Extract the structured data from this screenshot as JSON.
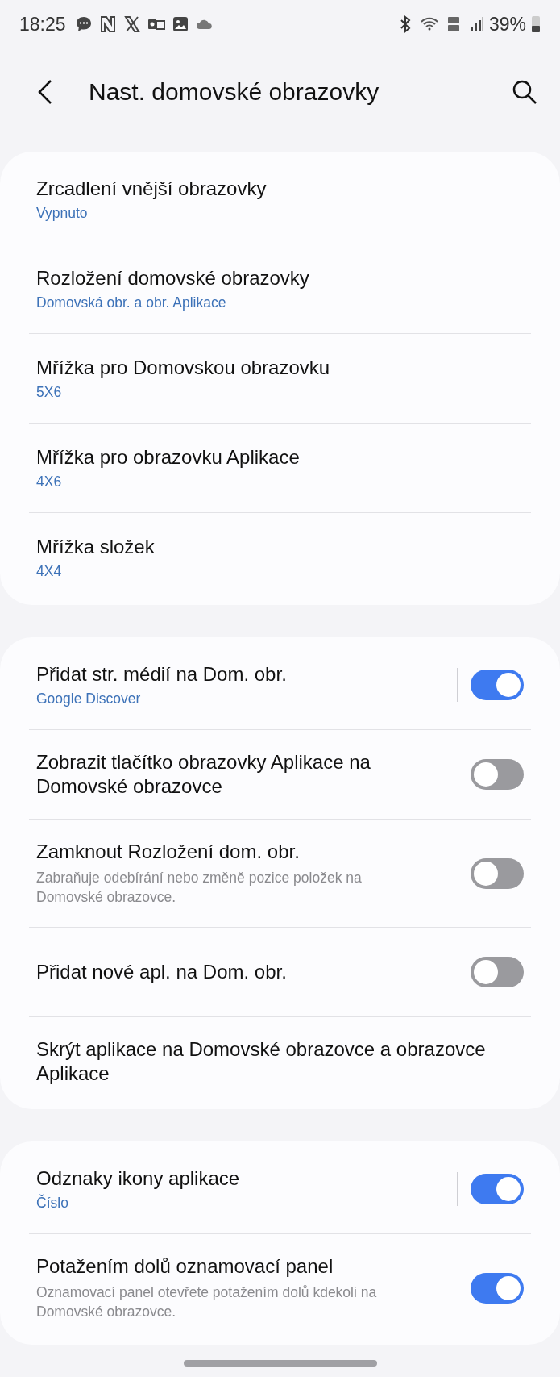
{
  "status_bar": {
    "time": "18:25",
    "battery": "39%"
  },
  "header": {
    "title": "Nast. domovské obrazovky"
  },
  "groups": [
    {
      "items": [
        {
          "kind": "link",
          "title": "Zrcadlení vnější obrazovky",
          "value": "Vypnuto"
        },
        {
          "kind": "link",
          "title": "Rozložení domovské obrazovky",
          "value": "Domovská obr. a obr. Aplikace"
        },
        {
          "kind": "link",
          "title": "Mřížka pro Domovskou obrazovku",
          "value": "5X6"
        },
        {
          "kind": "link",
          "title": "Mřížka pro obrazovku Aplikace",
          "value": "4X6"
        },
        {
          "kind": "link",
          "title": "Mřížka složek",
          "value": "4X4"
        }
      ]
    },
    {
      "items": [
        {
          "kind": "split-switch",
          "title": "Přidat str. médií na Dom. obr.",
          "value": "Google Discover",
          "on": true
        },
        {
          "kind": "switch",
          "title": "Zobrazit tlačítko obrazovky Aplikace na Domovské obrazovce",
          "on": false
        },
        {
          "kind": "switch",
          "title": "Zamknout Rozložení dom. obr.",
          "description": "Zabraňuje odebírání nebo změně pozice položek na Domovské obrazovce.",
          "on": false
        },
        {
          "kind": "switch",
          "title": "Přidat nové apl. na Dom. obr.",
          "on": false
        },
        {
          "kind": "link",
          "title": "Skrýt aplikace na Domovské obrazovce a obrazovce Aplikace"
        }
      ]
    },
    {
      "items": [
        {
          "kind": "split-switch",
          "title": "Odznaky ikony aplikace",
          "value": "Číslo",
          "on": true
        },
        {
          "kind": "switch",
          "title": "Potažením dolů oznamovací panel",
          "description": "Oznamovací panel otevřete potažením dolů kdekoli na Domovské obrazovce.",
          "on": true
        }
      ]
    }
  ]
}
